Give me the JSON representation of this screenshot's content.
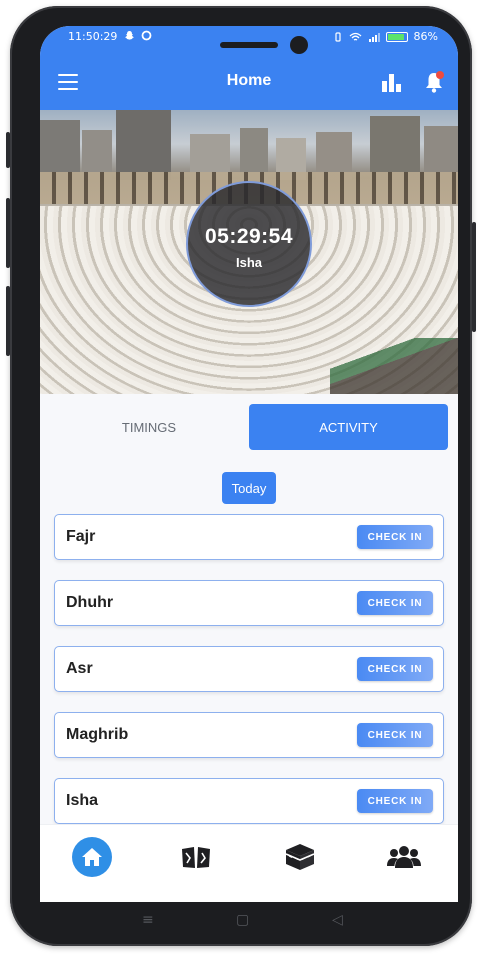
{
  "status_bar": {
    "time": "11:50:29",
    "battery": "86%"
  },
  "app_bar": {
    "title": "Home"
  },
  "timer": {
    "countdown": "05:29:54",
    "prayer": "Isha"
  },
  "tabs": [
    {
      "label": "TIMINGS",
      "active": false
    },
    {
      "label": "ACTIVITY",
      "active": true
    }
  ],
  "day_selector": {
    "label": "Today"
  },
  "prayers": [
    {
      "name": "Fajr",
      "action": "CHECK IN"
    },
    {
      "name": "Dhuhr",
      "action": "CHECK IN"
    },
    {
      "name": "Asr",
      "action": "CHECK IN"
    },
    {
      "name": "Maghrib",
      "action": "CHECK IN"
    },
    {
      "name": "Isha",
      "action": "CHECK IN"
    }
  ],
  "bottom_nav": [
    {
      "icon": "home-icon",
      "active": true
    },
    {
      "icon": "book-icon",
      "active": false
    },
    {
      "icon": "kaaba-icon",
      "active": false
    },
    {
      "icon": "group-icon",
      "active": false
    }
  ],
  "colors": {
    "primary": "#3b82f1",
    "nav_active": "#2f8fe6",
    "card_border": "#8db0ee",
    "background": "#f7f8fb"
  }
}
